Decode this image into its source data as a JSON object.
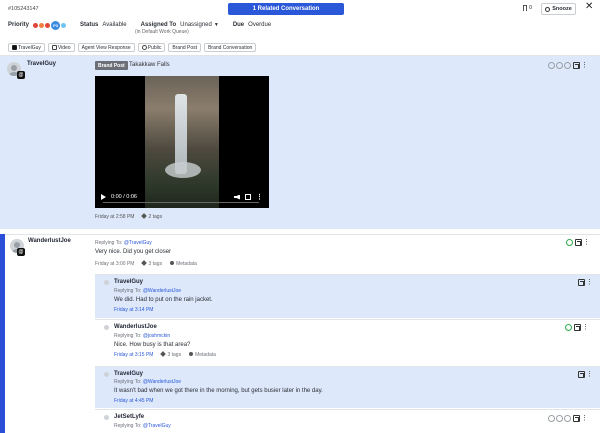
{
  "header": {
    "case_id": "#105243147",
    "related_label": "1 Related Conversation",
    "bookmark_count": "0",
    "snooze_label": "Snooze",
    "close_glyph": "✕",
    "priority_label": "Priority",
    "priority_value": "P3",
    "status_label": "Status",
    "status_value": "Available",
    "assigned_label": "Assigned To",
    "assigned_value": "Unassigned",
    "assigned_caret": "▼",
    "queue_note": "(in Default Work Queue)",
    "due_label": "Due",
    "due_value": "Overdue",
    "priority_colors": [
      "#e0453a",
      "#ef7f3a",
      "#e0453a",
      "#e0453a",
      "#3aa0e0",
      "#6fc4f0"
    ]
  },
  "tags": [
    "TravelGuy",
    "Video",
    "Agent View Response",
    "Public",
    "Brand Post",
    "Brand Conversation"
  ],
  "post": {
    "author": "TravelGuy",
    "brand_tag": "Brand Post",
    "title": "Takakkaw Falls",
    "time_display": "0:00 / 0:06",
    "timestamp": "Friday at 2:58 PM",
    "tag_count": "2 tags"
  },
  "thread": {
    "root": {
      "author": "WanderlustJoe",
      "reply_prefix": "Replying To:",
      "reply_to": "@TravelGuy",
      "body": "Very nice. Did you get closer",
      "timestamp": "Friday at 3:00 PM",
      "tag_count": "3 tags",
      "metadata_label": "Metadata"
    },
    "replies": [
      {
        "author": "TravelGuy",
        "reply_prefix": "Replying To:",
        "reply_to": "@WanderlustJoe",
        "body": "We did. Had to put on the rain jacket.",
        "timestamp": "Friday at 3:14 PM"
      },
      {
        "author": "WanderlustJoe",
        "reply_prefix": "Replying To:",
        "reply_to": "@joshmckin",
        "body": "Nice. How busy is that area?",
        "timestamp": "Friday at 3:15 PM",
        "tag_count": "3 tags",
        "metadata_label": "Metadata"
      },
      {
        "author": "TravelGuy",
        "reply_prefix": "Replying To:",
        "reply_to": "@WanderlustJoe",
        "body": "It wasn't bad when we got there in the morning, but gets busier later in the day.",
        "timestamp": "Friday at 4:45 PM"
      },
      {
        "author": "JetSetLyfe",
        "reply_prefix": "Replying To:",
        "reply_to": "@TravelGuy"
      }
    ]
  }
}
